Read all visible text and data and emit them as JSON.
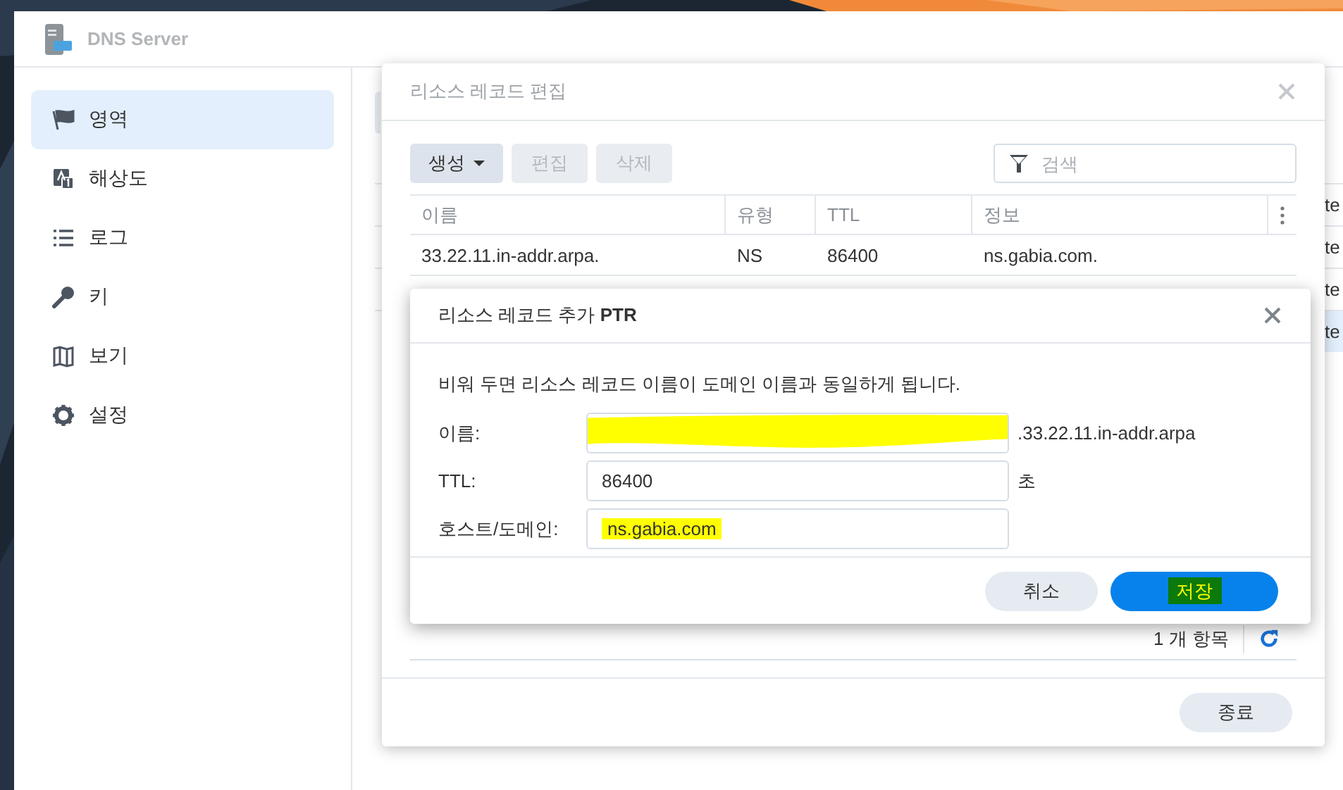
{
  "app": {
    "title": "DNS Server"
  },
  "sidebar": {
    "items": [
      {
        "label": "영역",
        "selected": true
      },
      {
        "label": "해상도",
        "selected": false
      },
      {
        "label": "로그",
        "selected": false
      },
      {
        "label": "키",
        "selected": false
      },
      {
        "label": "보기",
        "selected": false
      },
      {
        "label": "설정",
        "selected": false
      }
    ]
  },
  "zone_list": {
    "rows": [
      {
        "column_1": "te",
        "selected": false
      },
      {
        "column_1": "te",
        "selected": false
      },
      {
        "column_1": "te",
        "selected": false
      },
      {
        "column_1": "te",
        "selected": true
      }
    ]
  },
  "record_editor": {
    "title": "리소스 레코드 편집",
    "toolbar": [
      {
        "label": "생성",
        "kind": "menu",
        "disabled": false
      },
      {
        "label": "편집",
        "kind": "button",
        "disabled": true
      },
      {
        "label": "삭제",
        "kind": "button",
        "disabled": true
      }
    ],
    "search": {
      "placeholder": "검색"
    },
    "table": {
      "columns": [
        "이름",
        "유형",
        "TTL",
        "정보"
      ],
      "rows": [
        [
          "33.22.11.in-addr.arpa.",
          "NS",
          "86400",
          "ns.gabia.com."
        ]
      ]
    },
    "item_count": "1 개 항목",
    "close_button": "종료"
  },
  "add_dialog": {
    "title": "리소스 레코드 추가 **PTR**",
    "hint": "비워 두면 리소스 레코드 이름이 도메인 이름과 동일하게 됩니다.",
    "fields": [
      {
        "label": "이름:",
        "suffix": ".33.22.11.in-addr.arpa",
        "kind": "scribbled"
      },
      {
        "label": "TTL:",
        "value": "86400",
        "suffix": "초",
        "kind": "plain"
      },
      {
        "label": "호스트/도메인:",
        "value": "ns.gabia.com",
        "kind": "highlighted"
      }
    ],
    "buttons": [
      {
        "label": "취소",
        "kind": "secondary",
        "highlighted": false
      },
      {
        "label": "저장",
        "kind": "primary",
        "highlighted": true
      }
    ]
  }
}
